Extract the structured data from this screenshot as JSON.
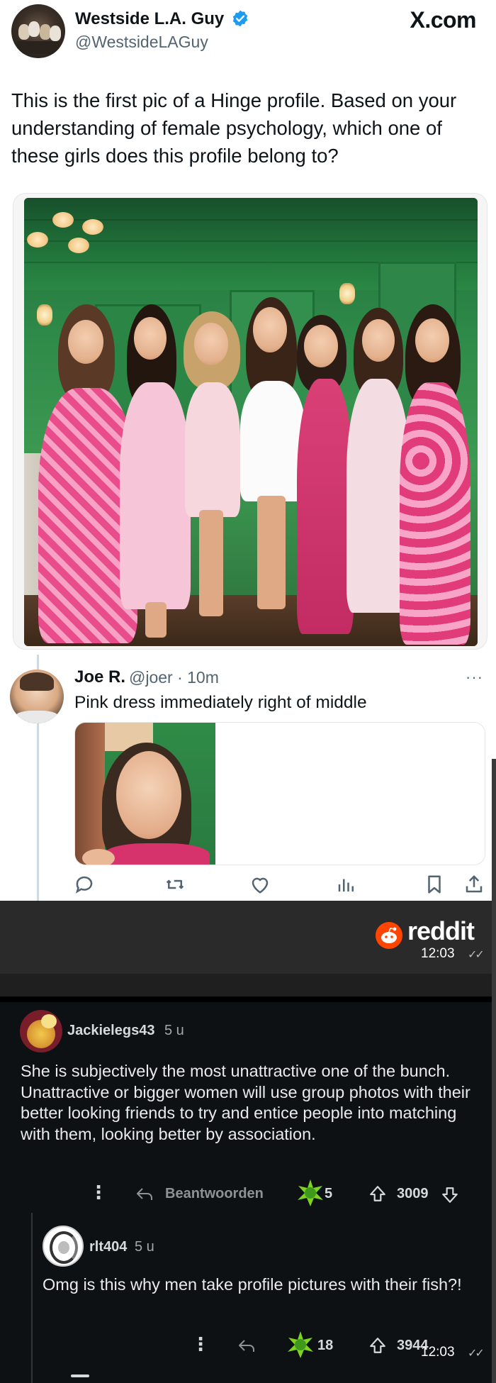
{
  "tweet": {
    "author_name": "Westside L.A. Guy",
    "author_handle": "@WestsideLAGuy",
    "source_label": "X.com",
    "text": "This is the first pic of a Hinge profile. Based on your understanding of female psychology, which one of these girls does this profile belong to?"
  },
  "reply": {
    "author_name": "Joe R.",
    "author_meta": "@joer · 10m",
    "more_label": "···",
    "text": "Pink dress immediately right of middle"
  },
  "reddit": {
    "brand": "reddit",
    "top_timestamp": "12:03",
    "bottom_timestamp": "12:03",
    "comments": [
      {
        "username": "Jackielegs43",
        "age": "5 u",
        "text": "She is subjectively the most unattractive one of the bunch. Unattractive or bigger women will use group photos with their better looking friends to try and entice people into matching with them, looking better by association.",
        "more": "⋮",
        "reply_label": "Beantwoorden",
        "award_count": "5",
        "score": "3009"
      },
      {
        "username": "rlt404",
        "age": "5 u",
        "text": "Omg is this why men take profile pictures with their fish?!",
        "more": "⋮",
        "award_count": "18",
        "score": "3944"
      }
    ]
  },
  "colors": {
    "x_text": "#0f1419",
    "x_secondary": "#536471",
    "verified_blue": "#1d9bf0",
    "reddit_orange": "#ff4500",
    "reddit_bg": "#0e1113",
    "award_green": "#7ed321"
  },
  "icons": [
    "verified-badge-icon",
    "heart-icon",
    "comment-icon",
    "repost-icon",
    "like-icon",
    "views-icon",
    "bookmark-icon",
    "share-icon",
    "reddit-logo-icon",
    "reply-icon",
    "award-icon",
    "upvote-icon",
    "downvote-icon",
    "read-ticks-icon"
  ]
}
